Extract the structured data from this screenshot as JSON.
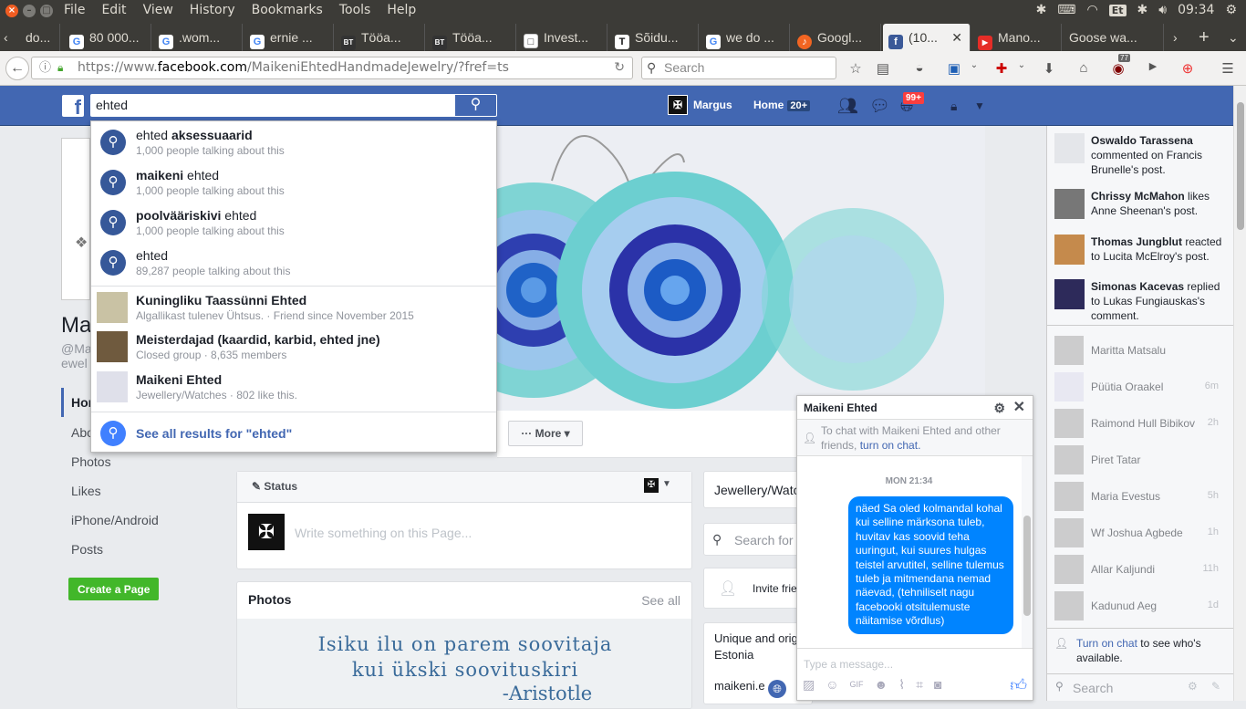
{
  "os": {
    "menu": [
      "File",
      "Edit",
      "View",
      "History",
      "Bookmarks",
      "Tools",
      "Help"
    ],
    "keyboard_layout": "Et",
    "clock": "09:34"
  },
  "browser": {
    "tabs": [
      {
        "label": "do...",
        "icon": "generic"
      },
      {
        "label": "80 000...",
        "icon": "google"
      },
      {
        "label": ".wom...",
        "icon": "google"
      },
      {
        "label": "ernie ...",
        "icon": "google"
      },
      {
        "label": "Tööa...",
        "icon": "bt"
      },
      {
        "label": "Tööa...",
        "icon": "bt"
      },
      {
        "label": "Invest...",
        "icon": "page"
      },
      {
        "label": "Sõidu...",
        "icon": "tm"
      },
      {
        "label": "we do ...",
        "icon": "google"
      },
      {
        "label": "Googl...",
        "icon": "orange"
      },
      {
        "label": "(10...",
        "icon": "facebook",
        "active": true
      },
      {
        "label": "Mano...",
        "icon": "youtube"
      },
      {
        "label": "Goose wa...",
        "icon": "none"
      }
    ],
    "url_prefix": "https://www.",
    "url_domain": "facebook.com",
    "url_path": "/MaikeniEhtedHandmadeJewelry/?fref=ts",
    "search_placeholder": "Search",
    "addon_badge": "77"
  },
  "fb": {
    "search_value": "ehted",
    "user_name": "Margus",
    "home_label": "Home",
    "home_count": "20+",
    "notif_count": "99+",
    "suggestions": [
      {
        "plain": "ehted ",
        "bold": "aksessuaarid",
        "sub": "1,000 people talking about this",
        "type": "search"
      },
      {
        "plain": " ehted",
        "bold": "maikeni",
        "sub": "1,000 people talking about this",
        "type": "search",
        "bold_first": true
      },
      {
        "plain": " ehted",
        "bold": "poolvääriskivi",
        "sub": "1,000 people talking about this",
        "type": "search",
        "bold_first": true
      },
      {
        "plain": "ehted",
        "bold": "",
        "sub": "89,287 people talking about this",
        "type": "search"
      },
      {
        "plain": "",
        "bold": "Kuningliku Taassünni Ehted",
        "sub": "Algallikast tulenev Ühtsus. · Friend since November 2015",
        "type": "page"
      },
      {
        "plain": "",
        "bold": "Meisterdajad (kaardid, karbid, ehted jne)",
        "sub": "Closed group · 8,635 members",
        "type": "group"
      },
      {
        "plain": "",
        "bold": "Maikeni Ehted",
        "sub": "Jewellery/Watches · 802 like this.",
        "type": "page2"
      }
    ],
    "see_all": "See all results for \"ehted\""
  },
  "page": {
    "title_partial": "Ma",
    "handle_partial": "@Ma",
    "handle_partial2": "ewel",
    "nav": [
      "Hom",
      "Abo",
      "Photos",
      "Likes",
      "iPhone/Android",
      "Posts"
    ],
    "create_page": "Create a Page",
    "more_label": "More",
    "status_label": "Status",
    "composer_placeholder": "Write something on this Page...",
    "photos_title": "Photos",
    "see_all_label": "See all",
    "quote_lines": [
      "Isiku ilu on parem soovitaja",
      "kui ükski soovituskiri",
      "-Aristotle"
    ],
    "category_partial": "Jewellery/Watc",
    "search_partial": "Search for",
    "invite_partial": "Invite frie",
    "about_partial1": "Unique and orig",
    "about_partial2": "Estonia",
    "website_partial": "maikeni.e"
  },
  "ticker": [
    {
      "name": "Oswaldo Tarassena",
      "text": " commented on Francis Brunelle's post."
    },
    {
      "name": "Chrissy McMahon",
      "text": " likes Anne Sheenan's post."
    },
    {
      "name": "Thomas Jungblut",
      "text": " reacted to Lucita McElroy's post."
    },
    {
      "name": "Simonas Kacevas",
      "text": " replied to Lukas Fungiauskas's comment."
    }
  ],
  "friends": [
    {
      "name": "Maritta Matsalu",
      "time": ""
    },
    {
      "name": "Püütia Oraakel",
      "time": "6m"
    },
    {
      "name": "Raimond Hull Bibikov",
      "time": "2h"
    },
    {
      "name": "Piret Tatar",
      "time": ""
    },
    {
      "name": "Maria Evestus",
      "time": "5h"
    },
    {
      "name": "Wf Joshua Agbede",
      "time": "1h"
    },
    {
      "name": "Allar Kaljundi",
      "time": "11h"
    },
    {
      "name": "Kadunud Aeg",
      "time": "1d"
    }
  ],
  "chat_sidebar": {
    "turn_on_link": "Turn on chat",
    "turn_on_text": " to see who's available.",
    "search_placeholder": "Search"
  },
  "chat": {
    "title": "Maikeni Ehted",
    "notice": "To chat with Maikeni Ehted and other friends, ",
    "notice_link": "turn on chat.",
    "timestamp": "MON 21:34",
    "message": "näed Sa oled kolmandal kohal kui selline märksona tuleb, huvitav kas soovid teha uuringut, kui suures hulgas teistel arvutitel, selline tulemus tuleb ja mitmendana nemad näevad, (tehniliselt nagu facebooki otsitulemuste näitamise võrdlus)",
    "input_placeholder": "Type a message..."
  }
}
